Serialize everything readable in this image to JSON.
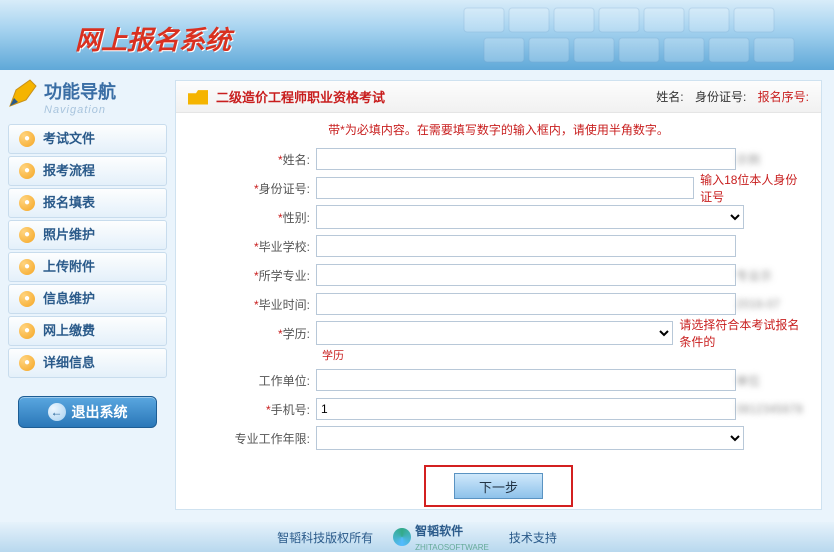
{
  "header": {
    "title": "网上报名系统"
  },
  "sidebar": {
    "title": "功能导航",
    "subtitle": "Navigation",
    "items": [
      {
        "label": "考试文件"
      },
      {
        "label": "报考流程"
      },
      {
        "label": "报名填表"
      },
      {
        "label": "照片维护"
      },
      {
        "label": "上传附件"
      },
      {
        "label": "信息维护"
      },
      {
        "label": "网上缴费"
      },
      {
        "label": "详细信息"
      }
    ],
    "exit_label": "退出系统"
  },
  "panel": {
    "title": "二级造价工程师职业资格考试",
    "meta_name_label": "姓名:",
    "meta_id_label": "身份证号:",
    "meta_seq_label": "报名序号:",
    "notice": "带*为必填内容。在需要填写数字的输入框内，请使用半角数字。"
  },
  "form": {
    "name": {
      "label": "姓名:",
      "value": ""
    },
    "idnum": {
      "label": "身份证号:",
      "value": "",
      "hint": "输入18位本人身份证号"
    },
    "gender": {
      "label": "性别:",
      "value": ""
    },
    "school": {
      "label": "毕业学校:",
      "value": ""
    },
    "major": {
      "label": "所学专业:",
      "value": ""
    },
    "gradtime": {
      "label": "毕业时间:",
      "value": ""
    },
    "edu": {
      "label": "学历:",
      "value": "",
      "hint": "请选择符合本考试报名条件的",
      "subhint": "学历"
    },
    "workunit": {
      "label": "工作单位:",
      "value": ""
    },
    "phone": {
      "label": "手机号:",
      "value": "1"
    },
    "workyears": {
      "label": "专业工作年限:",
      "value": ""
    }
  },
  "buttons": {
    "next": "下一步"
  },
  "footer": {
    "copyright": "智韬科技版权所有",
    "brand": "智韬软件",
    "brand_en": "ZHITAOSOFTWARE",
    "support": "技术支持"
  }
}
